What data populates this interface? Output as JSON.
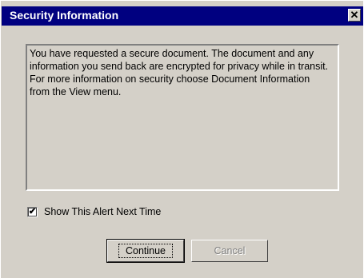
{
  "window": {
    "title": "Security Information",
    "close_glyph": "✕"
  },
  "message": "You have requested a secure document. The document and any information you send back are encrypted for privacy while in transit. For more information on security choose Document Information from the View menu.",
  "checkbox": {
    "label": "Show This Alert Next Time",
    "checked": true,
    "check_glyph": "✔"
  },
  "buttons": {
    "continue_label": "Continue",
    "cancel_label": "Cancel"
  }
}
